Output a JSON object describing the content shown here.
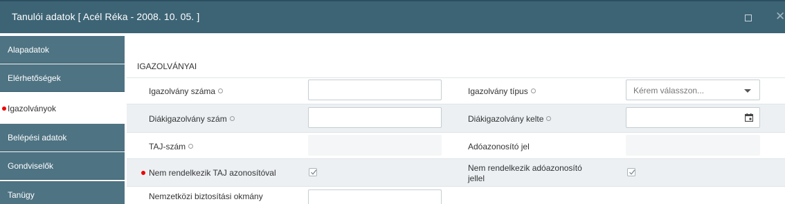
{
  "window": {
    "title": "Tanulói adatok [ Acél Réka - 2008. 10. 05. ]"
  },
  "sidebar": {
    "items": [
      {
        "label": "Alapadatok"
      },
      {
        "label": "Elérhetőségek"
      },
      {
        "label": "Igazolványok"
      },
      {
        "label": "Belépési adatok"
      },
      {
        "label": "Gondviselők"
      },
      {
        "label": "Tanügy"
      }
    ]
  },
  "section": {
    "title": "IGAZOLVÁNYAI"
  },
  "form": {
    "id_number_label": "Igazolvány száma",
    "id_number_value": "",
    "id_type_label": "Igazolvány típus",
    "id_type_placeholder": "Kérem válasszon...",
    "student_id_label": "Diákigazolvány szám",
    "student_id_value": "",
    "student_id_date_label": "Diákigazolvány kelte",
    "student_id_date_value": "",
    "taj_label": "TAJ-szám",
    "tax_id_label": "Adóazonosító jel",
    "no_taj_label": "Nem rendelkezik TAJ azonosítóval",
    "no_taj_checked": true,
    "no_tax_label_line1": "Nem rendelkezik adóazonosító",
    "no_tax_label_line2": "jellel",
    "no_tax_checked": true,
    "intl_insurance_label": "Nemzetközi biztosítási okmány",
    "intl_insurance_value": ""
  },
  "colors": {
    "titlebar": "#3d6475",
    "sidebar": "#4e7383",
    "required_dot": "#e00000"
  },
  "icons": {
    "maximize": "maximize-icon",
    "close": "close-icon",
    "info": "info-icon",
    "calendar": "calendar-icon",
    "dropdown": "chevron-down-icon",
    "check": "check-icon"
  }
}
